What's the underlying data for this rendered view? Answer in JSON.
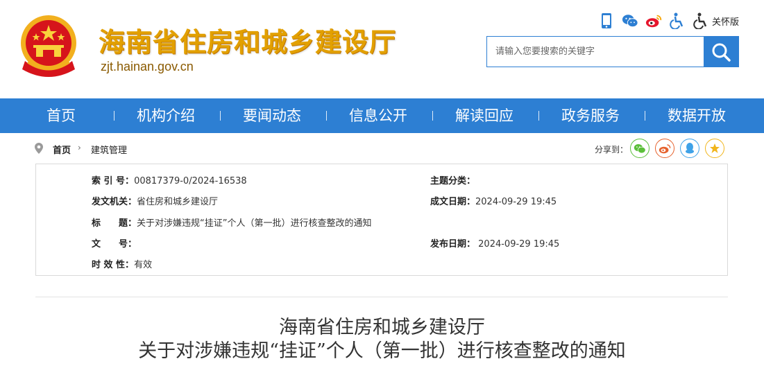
{
  "header": {
    "site_title": "海南省住房和城乡建设厅",
    "site_domain": "zjt.hainan.gov.cn",
    "care_mode_label": "关怀版",
    "search_placeholder": "请输入您要搜索的关键字",
    "colors": {
      "title": "#e2a000",
      "accent": "#2d7fd3"
    }
  },
  "tool_icons": [
    "mobile-icon",
    "wechat-icon",
    "weibo-icon",
    "accessibility-icon",
    "care-mode-icon"
  ],
  "nav": {
    "items": [
      "首页",
      "机构介绍",
      "要闻动态",
      "信息公开",
      "解读回应",
      "政务服务",
      "数据开放"
    ]
  },
  "breadcrumb": {
    "home": "首页",
    "separator": "›",
    "current": "建筑管理"
  },
  "share": {
    "label": "分享到：",
    "targets": [
      "wechat-share-icon",
      "weibo-share-icon",
      "qq-share-icon",
      "qzone-share-icon"
    ]
  },
  "info": {
    "index_label": "索 引 号：",
    "index_value": "00817379-0/2024-16538",
    "category_label": "主题分类：",
    "category_value": "",
    "issuer_label": "发文机关：",
    "issuer_value": "省住房和城乡建设厅",
    "created_label": "成文日期：",
    "created_value": "2024-09-29 19:45",
    "title_label": "标　　题：",
    "title_value": "关于对涉嫌违规“挂证”个人（第一批）进行核查整改的通知",
    "docno_label": "文　　号：",
    "docno_value": "",
    "published_label": "发布日期：",
    "published_value": " 2024-09-29 19:45",
    "validity_label": "时 效 性：",
    "validity_value": "有效"
  },
  "document": {
    "title_line1": "海南省住房和城乡建设厅",
    "title_line2": "关于对涉嫌违规“挂证”个人（第一批）进行核查整改的通知"
  }
}
